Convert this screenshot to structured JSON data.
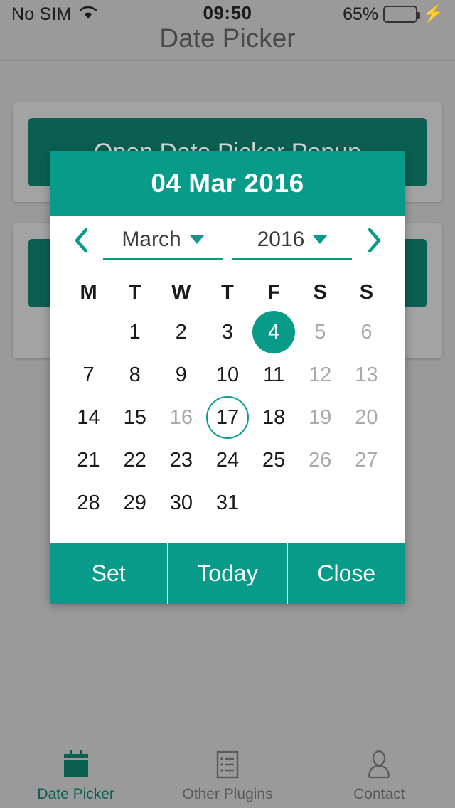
{
  "status_bar": {
    "carrier": "No SIM",
    "wifi_icon": "wifi-icon",
    "time": "09:50",
    "battery_percent": "65%",
    "battery_level": 65,
    "charging_icon": "lightning-bolt-icon",
    "battery_fill_color": "#4cd964"
  },
  "navbar": {
    "title": "Date Picker"
  },
  "background": {
    "button_1": "Open Date Picker Popup",
    "button_2": "",
    "button_color": "#0a5f51"
  },
  "dialog": {
    "header_date": "04 Mar 2016",
    "accent_color": "#089b8a",
    "prev_icon": "chevron-left-icon",
    "next_icon": "chevron-right-icon",
    "month": "March",
    "year": "2016",
    "month_caret_icon": "caret-down-icon",
    "year_caret_icon": "caret-down-icon",
    "weekdays": [
      "M",
      "T",
      "W",
      "T",
      "F",
      "S",
      "S"
    ],
    "weeks": [
      [
        {
          "label": "",
          "state": "empty"
        },
        {
          "label": "1",
          "state": "normal"
        },
        {
          "label": "2",
          "state": "normal"
        },
        {
          "label": "3",
          "state": "normal"
        },
        {
          "label": "4",
          "state": "selected"
        },
        {
          "label": "5",
          "state": "dim"
        },
        {
          "label": "6",
          "state": "dim"
        }
      ],
      [
        {
          "label": "7",
          "state": "normal"
        },
        {
          "label": "8",
          "state": "normal"
        },
        {
          "label": "9",
          "state": "normal"
        },
        {
          "label": "10",
          "state": "normal"
        },
        {
          "label": "11",
          "state": "normal"
        },
        {
          "label": "12",
          "state": "dim"
        },
        {
          "label": "13",
          "state": "dim"
        }
      ],
      [
        {
          "label": "14",
          "state": "normal"
        },
        {
          "label": "15",
          "state": "normal"
        },
        {
          "label": "16",
          "state": "dim"
        },
        {
          "label": "17",
          "state": "today"
        },
        {
          "label": "18",
          "state": "normal"
        },
        {
          "label": "19",
          "state": "dim"
        },
        {
          "label": "20",
          "state": "dim"
        }
      ],
      [
        {
          "label": "21",
          "state": "normal"
        },
        {
          "label": "22",
          "state": "normal"
        },
        {
          "label": "23",
          "state": "normal"
        },
        {
          "label": "24",
          "state": "normal"
        },
        {
          "label": "25",
          "state": "normal"
        },
        {
          "label": "26",
          "state": "dim"
        },
        {
          "label": "27",
          "state": "dim"
        }
      ],
      [
        {
          "label": "28",
          "state": "normal"
        },
        {
          "label": "29",
          "state": "normal"
        },
        {
          "label": "30",
          "state": "normal"
        },
        {
          "label": "31",
          "state": "normal"
        },
        {
          "label": "",
          "state": "empty"
        },
        {
          "label": "",
          "state": "empty"
        },
        {
          "label": "",
          "state": "empty"
        }
      ]
    ],
    "buttons": [
      {
        "label": "Set"
      },
      {
        "label": "Today"
      },
      {
        "label": "Close"
      }
    ]
  },
  "tabbar": {
    "items": [
      {
        "label": "Date Picker",
        "icon": "calendar-icon",
        "active": true
      },
      {
        "label": "Other Plugins",
        "icon": "list-icon",
        "active": false
      },
      {
        "label": "Contact",
        "icon": "person-icon",
        "active": false
      }
    ],
    "active_color": "#0a5f51",
    "inactive_color": "#5a5a5a"
  }
}
